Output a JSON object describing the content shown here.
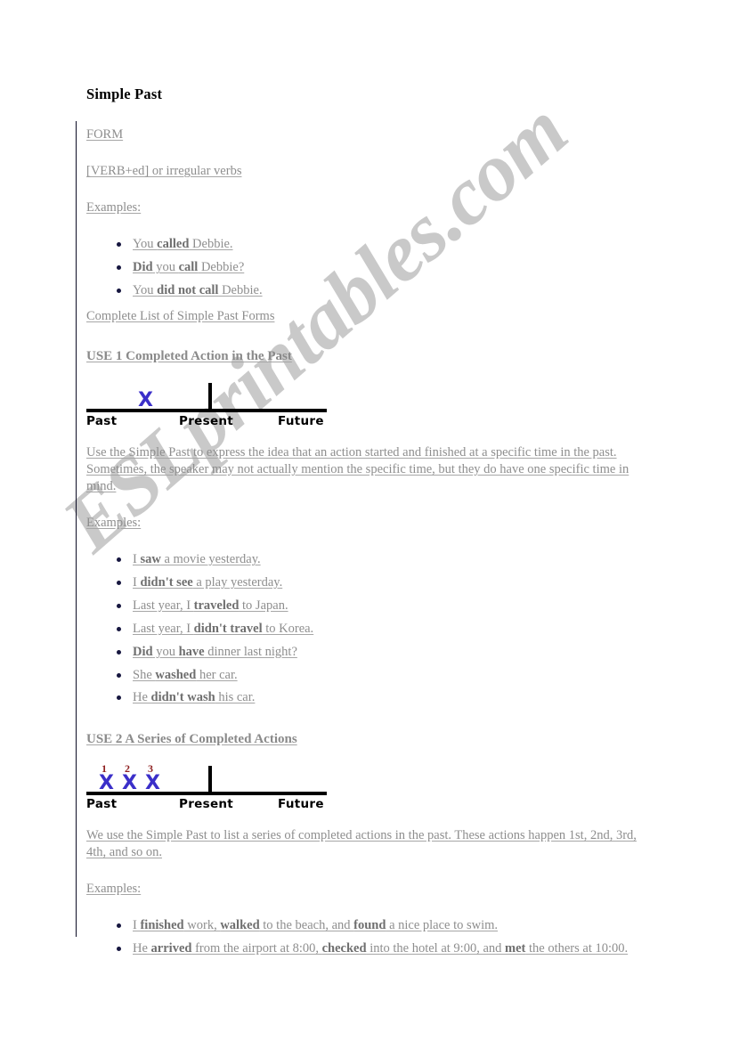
{
  "document": {
    "title": "Simple Past",
    "watermark": "ESLprintables.com",
    "colors": {
      "body_text": "#8e8e8e",
      "title_text": "#000000",
      "bullet": "#16163f",
      "timeline_line": "#000000",
      "timeline_mark": "#3b2fc9",
      "timeline_number": "#8e2020",
      "watermark": "#c9c9c9",
      "margin_rule": "#0d0d26"
    }
  },
  "form_section": {
    "heading": "FORM",
    "formula": "[VERB+ed] or irregular verbs",
    "examples_label": "Examples:",
    "examples": [
      {
        "parts": [
          {
            "text": "You ",
            "bold": false
          },
          {
            "text": "called",
            "bold": true
          },
          {
            "text": " Debbie.",
            "bold": false
          }
        ]
      },
      {
        "parts": [
          {
            "text": "Did",
            "bold": true
          },
          {
            "text": " you ",
            "bold": false
          },
          {
            "text": "call",
            "bold": true
          },
          {
            "text": " Debbie?",
            "bold": false
          }
        ]
      },
      {
        "parts": [
          {
            "text": "You ",
            "bold": false
          },
          {
            "text": "did not call",
            "bold": true
          },
          {
            "text": " Debbie.",
            "bold": false
          }
        ]
      }
    ],
    "complete_list_link": "Complete List of Simple Past Forms"
  },
  "use1": {
    "heading": "USE 1 Completed Action in the Past",
    "timeline": {
      "labels": {
        "past": "Past",
        "present": "Present",
        "future": "Future"
      },
      "marks": [
        {
          "symbol": "X",
          "number": "",
          "position": 58
        }
      ]
    },
    "body": "Use the Simple Past to express the idea that an action started and finished at a specific time in the past. Sometimes, the speaker may not actually mention the specific time, but they do have one specific time in mind.",
    "examples_label": "Examples:",
    "examples": [
      {
        "parts": [
          {
            "text": "I ",
            "bold": false
          },
          {
            "text": "saw",
            "bold": true
          },
          {
            "text": " a movie yesterday.",
            "bold": false
          }
        ]
      },
      {
        "parts": [
          {
            "text": "I ",
            "bold": false
          },
          {
            "text": "didn't see",
            "bold": true
          },
          {
            "text": " a play yesterday.",
            "bold": false
          }
        ]
      },
      {
        "parts": [
          {
            "text": "Last year, I ",
            "bold": false
          },
          {
            "text": "traveled",
            "bold": true
          },
          {
            "text": " to Japan.",
            "bold": false
          }
        ]
      },
      {
        "parts": [
          {
            "text": "Last year, I ",
            "bold": false
          },
          {
            "text": "didn't travel",
            "bold": true
          },
          {
            "text": " to Korea.",
            "bold": false
          }
        ]
      },
      {
        "parts": [
          {
            "text": "Did",
            "bold": true
          },
          {
            "text": " you ",
            "bold": false
          },
          {
            "text": "have",
            "bold": true
          },
          {
            "text": " dinner last night?",
            "bold": false
          }
        ]
      },
      {
        "parts": [
          {
            "text": "She ",
            "bold": false
          },
          {
            "text": "washed",
            "bold": true
          },
          {
            "text": " her car.",
            "bold": false
          }
        ]
      },
      {
        "parts": [
          {
            "text": "He ",
            "bold": false
          },
          {
            "text": "didn't wash",
            "bold": true
          },
          {
            "text": " his car.",
            "bold": false
          }
        ]
      }
    ]
  },
  "use2": {
    "heading": "USE 2 A Series of Completed Actions",
    "timeline": {
      "labels": {
        "past": "Past",
        "present": "Present",
        "future": "Future"
      },
      "marks": [
        {
          "symbol": "X",
          "number": "1",
          "position": 14
        },
        {
          "symbol": "X",
          "number": "2",
          "position": 40
        },
        {
          "symbol": "X",
          "number": "3",
          "position": 66
        }
      ]
    },
    "body": "We use the Simple Past to list a series of completed actions in the past. These actions happen 1st, 2nd, 3rd, 4th, and so on.",
    "examples_label": "Examples:",
    "examples": [
      {
        "parts": [
          {
            "text": "I ",
            "bold": false
          },
          {
            "text": "finished",
            "bold": true
          },
          {
            "text": " work, ",
            "bold": false
          },
          {
            "text": "walked",
            "bold": true
          },
          {
            "text": " to the beach, and ",
            "bold": false
          },
          {
            "text": "found",
            "bold": true
          },
          {
            "text": " a nice place to swim.",
            "bold": false
          }
        ]
      },
      {
        "parts": [
          {
            "text": "He ",
            "bold": false
          },
          {
            "text": "arrived",
            "bold": true
          },
          {
            "text": " from the airport at 8:00, ",
            "bold": false
          },
          {
            "text": "checked",
            "bold": true
          },
          {
            "text": " into the hotel at 9:00, and ",
            "bold": false
          },
          {
            "text": "met",
            "bold": true
          },
          {
            "text": " the others at 10:00.",
            "bold": false
          }
        ]
      }
    ]
  }
}
